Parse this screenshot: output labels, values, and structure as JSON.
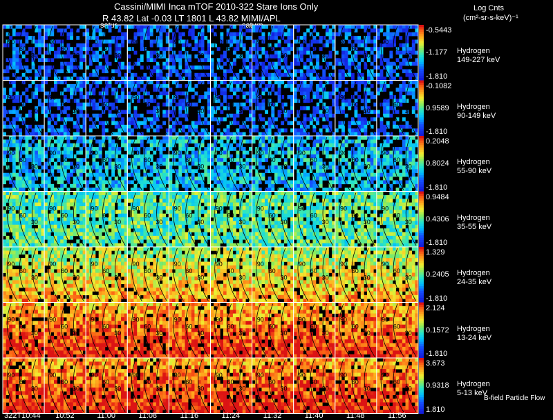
{
  "header": {
    "line1": "Cassini/MIMI Inca mTOF  2010-322   Stare   Ions Only",
    "line2": "R          43.82 Lat -0.03 LT 1801 L          43.82  MIMI/APL",
    "saturn_left": "satur",
    "saturn_right": "saturn",
    "units_line1": "Log Cnts",
    "units_line2": "(cm²-sr-s-keV)⁻¹"
  },
  "footer": {
    "bfield_label": "B-field Particle Flow"
  },
  "chart_data": {
    "type": "heatmap",
    "title": "Cassini/MIMI Inca mTOF  2010-322   Stare   Ions Only",
    "time_labels": [
      "322T10:44",
      "10:52",
      "11:00",
      "11:08",
      "11:16",
      "11:24",
      "11:32",
      "11:40",
      "11:48",
      "11:56"
    ],
    "bands": [
      {
        "species": "Hydrogen",
        "energy": "149-227 keV",
        "cb_max": "-0.5443",
        "cb_mid": "-1.177",
        "cb_min": "-1.810",
        "level": 0.18
      },
      {
        "species": "Hydrogen",
        "energy": "90-149 keV",
        "cb_max": "-0.1082",
        "cb_mid": "0.9589",
        "cb_min": "-1.810",
        "level": 0.2
      },
      {
        "species": "Hydrogen",
        "energy": "55-90 keV",
        "cb_max": "0.2048",
        "cb_mid": "0.8024",
        "cb_min": "-1.810",
        "level": 0.35
      },
      {
        "species": "Hydrogen",
        "energy": "35-55 keV",
        "cb_max": "0.9484",
        "cb_mid": "0.4306",
        "cb_min": "-1.810",
        "level": 0.5
      },
      {
        "species": "Hydrogen",
        "energy": "24-35 keV",
        "cb_max": "1.329",
        "cb_mid": "0.2405",
        "cb_min": "-1.810",
        "level": 0.58
      },
      {
        "species": "Hydrogen",
        "energy": "13-24 keV",
        "cb_max": "2.124",
        "cb_mid": "0.1572",
        "cb_min": "-1.810",
        "level": 0.78
      },
      {
        "species": "Hydrogen",
        "energy": "5-13 keV",
        "cb_max": "3.673",
        "cb_mid": "0.9318",
        "cb_min": "1.810",
        "level": 0.8
      }
    ],
    "contour_labels": [
      "90",
      "60",
      "30"
    ]
  }
}
